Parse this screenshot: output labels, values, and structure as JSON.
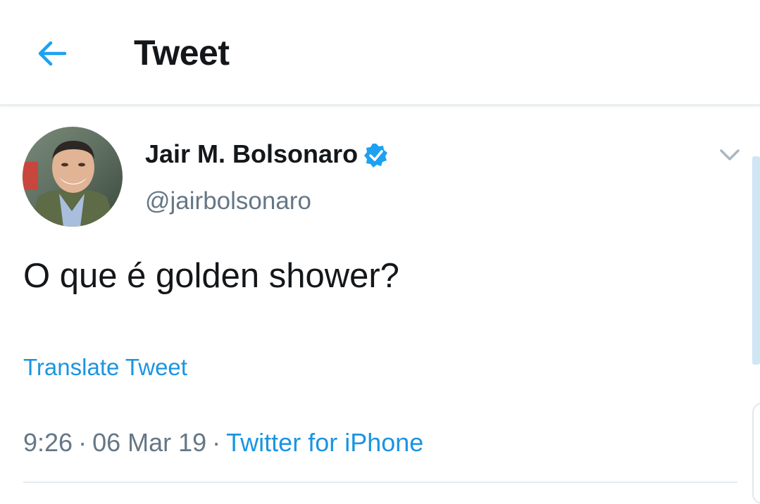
{
  "header": {
    "title": "Tweet",
    "back_icon": "arrow-left-icon"
  },
  "tweet": {
    "author": {
      "display_name": "Jair M. Bolsonaro",
      "handle": "@jairbolsonaro",
      "verified": true
    },
    "text": "O que é golden shower?",
    "translate_label": "Translate Tweet",
    "time": "9:26",
    "date": "06 Mar 19",
    "separator": "·",
    "source": "Twitter for iPhone",
    "menu_icon": "chevron-down-icon"
  },
  "colors": {
    "accent": "#1da1f2",
    "link": "#1b95e0",
    "secondary_text": "#657786",
    "primary_text": "#14171a",
    "divider": "#e6ecf0"
  }
}
